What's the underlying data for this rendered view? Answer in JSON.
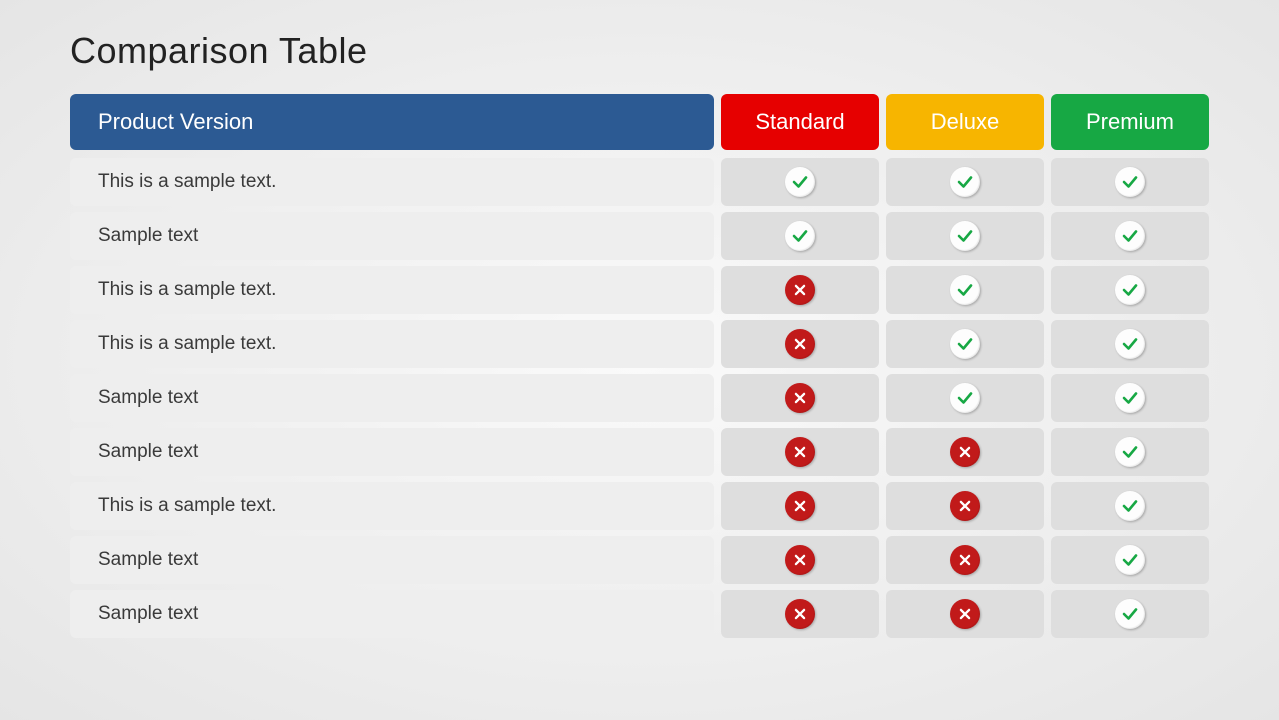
{
  "title": "Comparison Table",
  "columns": {
    "feature_header": "Product Version",
    "plans": [
      {
        "label": "Standard",
        "color": "#e60000"
      },
      {
        "label": "Deluxe",
        "color": "#f7b500"
      },
      {
        "label": "Premium",
        "color": "#17a844"
      }
    ],
    "feature_header_color": "#2c5a93"
  },
  "rows": [
    {
      "label": "This is a sample text.",
      "values": [
        "check",
        "check",
        "check"
      ]
    },
    {
      "label": "Sample text",
      "values": [
        "check",
        "check",
        "check"
      ]
    },
    {
      "label": "This is a sample text.",
      "values": [
        "cross",
        "check",
        "check"
      ]
    },
    {
      "label": "This is a sample text.",
      "values": [
        "cross",
        "check",
        "check"
      ]
    },
    {
      "label": "Sample text",
      "values": [
        "cross",
        "check",
        "check"
      ]
    },
    {
      "label": "Sample text",
      "values": [
        "cross",
        "cross",
        "check"
      ]
    },
    {
      "label": "This is a sample text.",
      "values": [
        "cross",
        "cross",
        "check"
      ]
    },
    {
      "label": "Sample text",
      "values": [
        "cross",
        "cross",
        "check"
      ]
    },
    {
      "label": "Sample text",
      "values": [
        "cross",
        "cross",
        "check"
      ]
    }
  ]
}
